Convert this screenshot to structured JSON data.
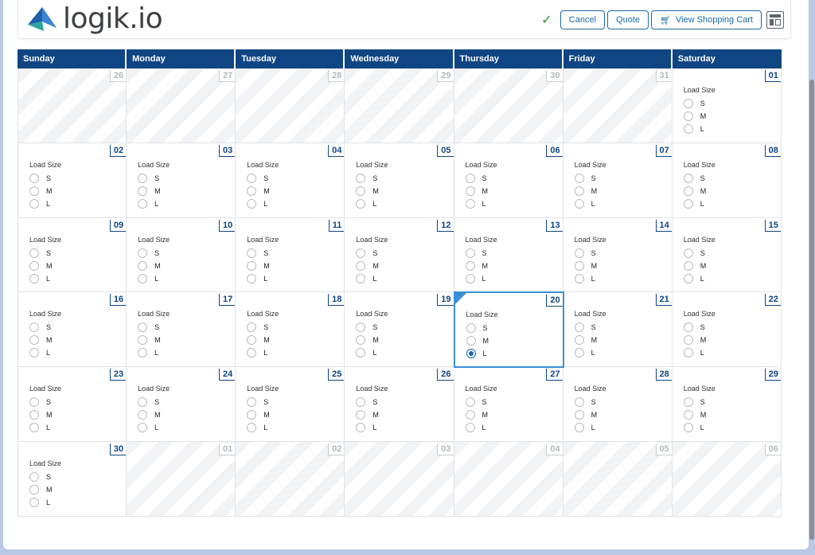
{
  "brand": {
    "name": "logik.io"
  },
  "toolbar": {
    "cancel_label": "Cancel",
    "quote_label": "Quote",
    "cart_label": "View Shopping Cart"
  },
  "calendar": {
    "weekdays": [
      "Sunday",
      "Monday",
      "Tuesday",
      "Wednesday",
      "Thursday",
      "Friday",
      "Saturday"
    ],
    "field_label": "Load Size",
    "options": [
      "S",
      "M",
      "L"
    ],
    "weeks": [
      [
        {
          "n": "26",
          "off": true
        },
        {
          "n": "27",
          "off": true
        },
        {
          "n": "28",
          "off": true
        },
        {
          "n": "29",
          "off": true
        },
        {
          "n": "30",
          "off": true
        },
        {
          "n": "31",
          "off": true
        },
        {
          "n": "01",
          "off": false
        }
      ],
      [
        {
          "n": "02",
          "off": false
        },
        {
          "n": "03",
          "off": false
        },
        {
          "n": "04",
          "off": false
        },
        {
          "n": "05",
          "off": false
        },
        {
          "n": "06",
          "off": false
        },
        {
          "n": "07",
          "off": false
        },
        {
          "n": "08",
          "off": false
        }
      ],
      [
        {
          "n": "09",
          "off": false
        },
        {
          "n": "10",
          "off": false
        },
        {
          "n": "11",
          "off": false
        },
        {
          "n": "12",
          "off": false
        },
        {
          "n": "13",
          "off": false
        },
        {
          "n": "14",
          "off": false
        },
        {
          "n": "15",
          "off": false
        }
      ],
      [
        {
          "n": "16",
          "off": false
        },
        {
          "n": "17",
          "off": false
        },
        {
          "n": "18",
          "off": false
        },
        {
          "n": "19",
          "off": false
        },
        {
          "n": "20",
          "off": false,
          "selected": true,
          "value": "L"
        },
        {
          "n": "21",
          "off": false
        },
        {
          "n": "22",
          "off": false
        }
      ],
      [
        {
          "n": "23",
          "off": false
        },
        {
          "n": "24",
          "off": false
        },
        {
          "n": "25",
          "off": false
        },
        {
          "n": "26",
          "off": false
        },
        {
          "n": "27",
          "off": false
        },
        {
          "n": "28",
          "off": false
        },
        {
          "n": "29",
          "off": false
        }
      ],
      [
        {
          "n": "30",
          "off": false
        },
        {
          "n": "01",
          "off": true
        },
        {
          "n": "02",
          "off": true
        },
        {
          "n": "03",
          "off": true
        },
        {
          "n": "04",
          "off": true
        },
        {
          "n": "05",
          "off": true
        },
        {
          "n": "06",
          "off": true
        }
      ]
    ]
  },
  "colors": {
    "header_bg": "#0f4583",
    "accent": "#1a6aa8",
    "selected_border": "#3a8fdc",
    "check": "#2e8b3a"
  },
  "icons": {
    "logo": "paper-plane-logo-icon",
    "status": "checkmark-icon",
    "cart": "shopping-cart-icon",
    "layout": "layout-toggle-icon"
  }
}
